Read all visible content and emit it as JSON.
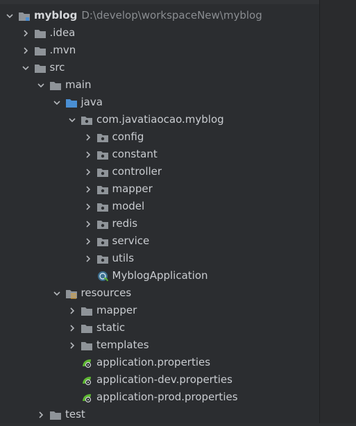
{
  "tree": {
    "root": {
      "name": "myblog",
      "path": "D:\\develop\\workspaceNew\\myblog"
    },
    "items": [
      {
        "label": ".idea",
        "indent": 1,
        "chevron": "right",
        "icon": "folder-icon"
      },
      {
        "label": ".mvn",
        "indent": 1,
        "chevron": "right",
        "icon": "folder-icon"
      },
      {
        "label": "src",
        "indent": 1,
        "chevron": "down",
        "icon": "folder-icon"
      },
      {
        "label": "main",
        "indent": 2,
        "chevron": "down",
        "icon": "folder-icon"
      },
      {
        "label": "java",
        "indent": 3,
        "chevron": "down",
        "icon": "source-folder-icon"
      },
      {
        "label": "com.javatiaocao.myblog",
        "indent": 4,
        "chevron": "down",
        "icon": "package-icon"
      },
      {
        "label": "config",
        "indent": 5,
        "chevron": "right",
        "icon": "package-icon"
      },
      {
        "label": "constant",
        "indent": 5,
        "chevron": "right",
        "icon": "package-icon"
      },
      {
        "label": "controller",
        "indent": 5,
        "chevron": "right",
        "icon": "package-icon"
      },
      {
        "label": "mapper",
        "indent": 5,
        "chevron": "right",
        "icon": "package-icon"
      },
      {
        "label": "model",
        "indent": 5,
        "chevron": "right",
        "icon": "package-icon"
      },
      {
        "label": "redis",
        "indent": 5,
        "chevron": "right",
        "icon": "package-icon"
      },
      {
        "label": "service",
        "indent": 5,
        "chevron": "right",
        "icon": "package-icon"
      },
      {
        "label": "utils",
        "indent": 5,
        "chevron": "right",
        "icon": "package-icon"
      },
      {
        "label": "MyblogApplication",
        "indent": 5,
        "chevron": "none",
        "icon": "spring-class-icon"
      },
      {
        "label": "resources",
        "indent": 3,
        "chevron": "down",
        "icon": "resources-folder-icon"
      },
      {
        "label": "mapper",
        "indent": 4,
        "chevron": "right",
        "icon": "folder-icon"
      },
      {
        "label": "static",
        "indent": 4,
        "chevron": "right",
        "icon": "folder-icon"
      },
      {
        "label": "templates",
        "indent": 4,
        "chevron": "right",
        "icon": "folder-icon"
      },
      {
        "label": "application.properties",
        "indent": 4,
        "chevron": "none",
        "icon": "spring-properties-icon"
      },
      {
        "label": "application-dev.properties",
        "indent": 4,
        "chevron": "none",
        "icon": "spring-properties-icon"
      },
      {
        "label": "application-prod.properties",
        "indent": 4,
        "chevron": "none",
        "icon": "spring-properties-icon"
      },
      {
        "label": "test",
        "indent": 2,
        "chevron": "right",
        "icon": "folder-icon"
      }
    ]
  },
  "colors": {
    "background": "#2b2d30",
    "text": "#c9ccd0",
    "folder": "#8f9499",
    "source_folder": "#4a8fd4",
    "spring_green": "#5fb832"
  }
}
